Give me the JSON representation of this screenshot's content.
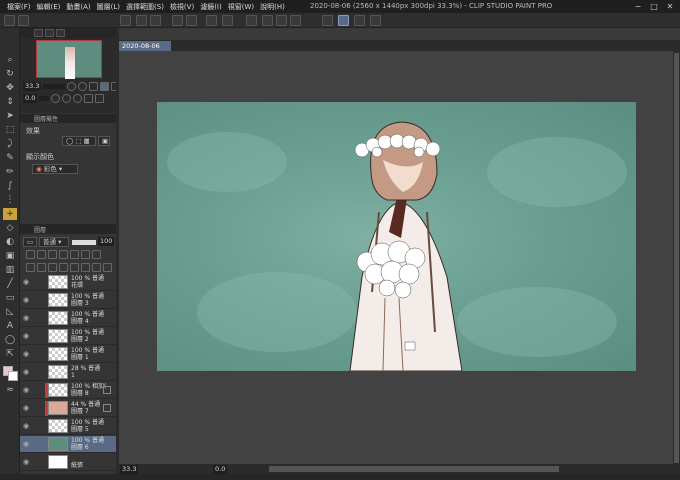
{
  "window": {
    "title": "2020-08-06 (2560 x 1440px 300dpi 33.3%) - CLIP STUDIO PAINT PRO",
    "controls": [
      "−",
      "□",
      "✕"
    ]
  },
  "menu": [
    "檔案(F)",
    "編輯(E)",
    "動畫(A)",
    "圖層(L)",
    "選擇範圍(S)",
    "檢視(V)",
    "濾鏡(I)",
    "視窗(W)",
    "說明(H)"
  ],
  "document_tab": "2020-08-06",
  "navigator": {
    "zoom": "33.3",
    "rotation": "0.0"
  },
  "property": {
    "tab_title": "圖層屬性",
    "effect_label": "效果",
    "display_color_label": "顯示顏色",
    "display_color_value": "彩色"
  },
  "layers_panel": {
    "tab_title": "圖層",
    "blend_mode": "普通",
    "opacity": "100"
  },
  "layers": [
    {
      "line1": "100 % 普通",
      "line2": "花環",
      "thumb": "check"
    },
    {
      "line1": "100 % 普通",
      "line2": "圖層 3",
      "thumb": "check"
    },
    {
      "line1": "100 % 普通",
      "line2": "圖層 4",
      "thumb": "check"
    },
    {
      "line1": "100 % 普通",
      "line2": "圖層 2",
      "thumb": "check"
    },
    {
      "line1": "100 % 普通",
      "line2": "圖層 1",
      "thumb": "check"
    },
    {
      "line1": "28 % 普通",
      "line2": "1",
      "thumb": "check"
    },
    {
      "line1": "100 % 相加(",
      "line2": "圖層 8",
      "thumb": "check",
      "clip": true
    },
    {
      "line1": "44 % 普通",
      "line2": "圖層 7",
      "thumb": "pic",
      "clip": true
    },
    {
      "line1": "100 % 普通",
      "line2": "圖層 5",
      "thumb": "check"
    },
    {
      "line1": "100 % 普通",
      "line2": "圖層 6",
      "thumb": "green",
      "selected": true
    },
    {
      "line1": "",
      "line2": "紙張",
      "thumb": "white"
    }
  ],
  "status": {
    "zoom": "33.3",
    "rotation": "0.0"
  },
  "colors": {
    "canvas_bg": "#6a9f92",
    "selection": "#5a6a84",
    "active_tool": "#c9a23a"
  }
}
